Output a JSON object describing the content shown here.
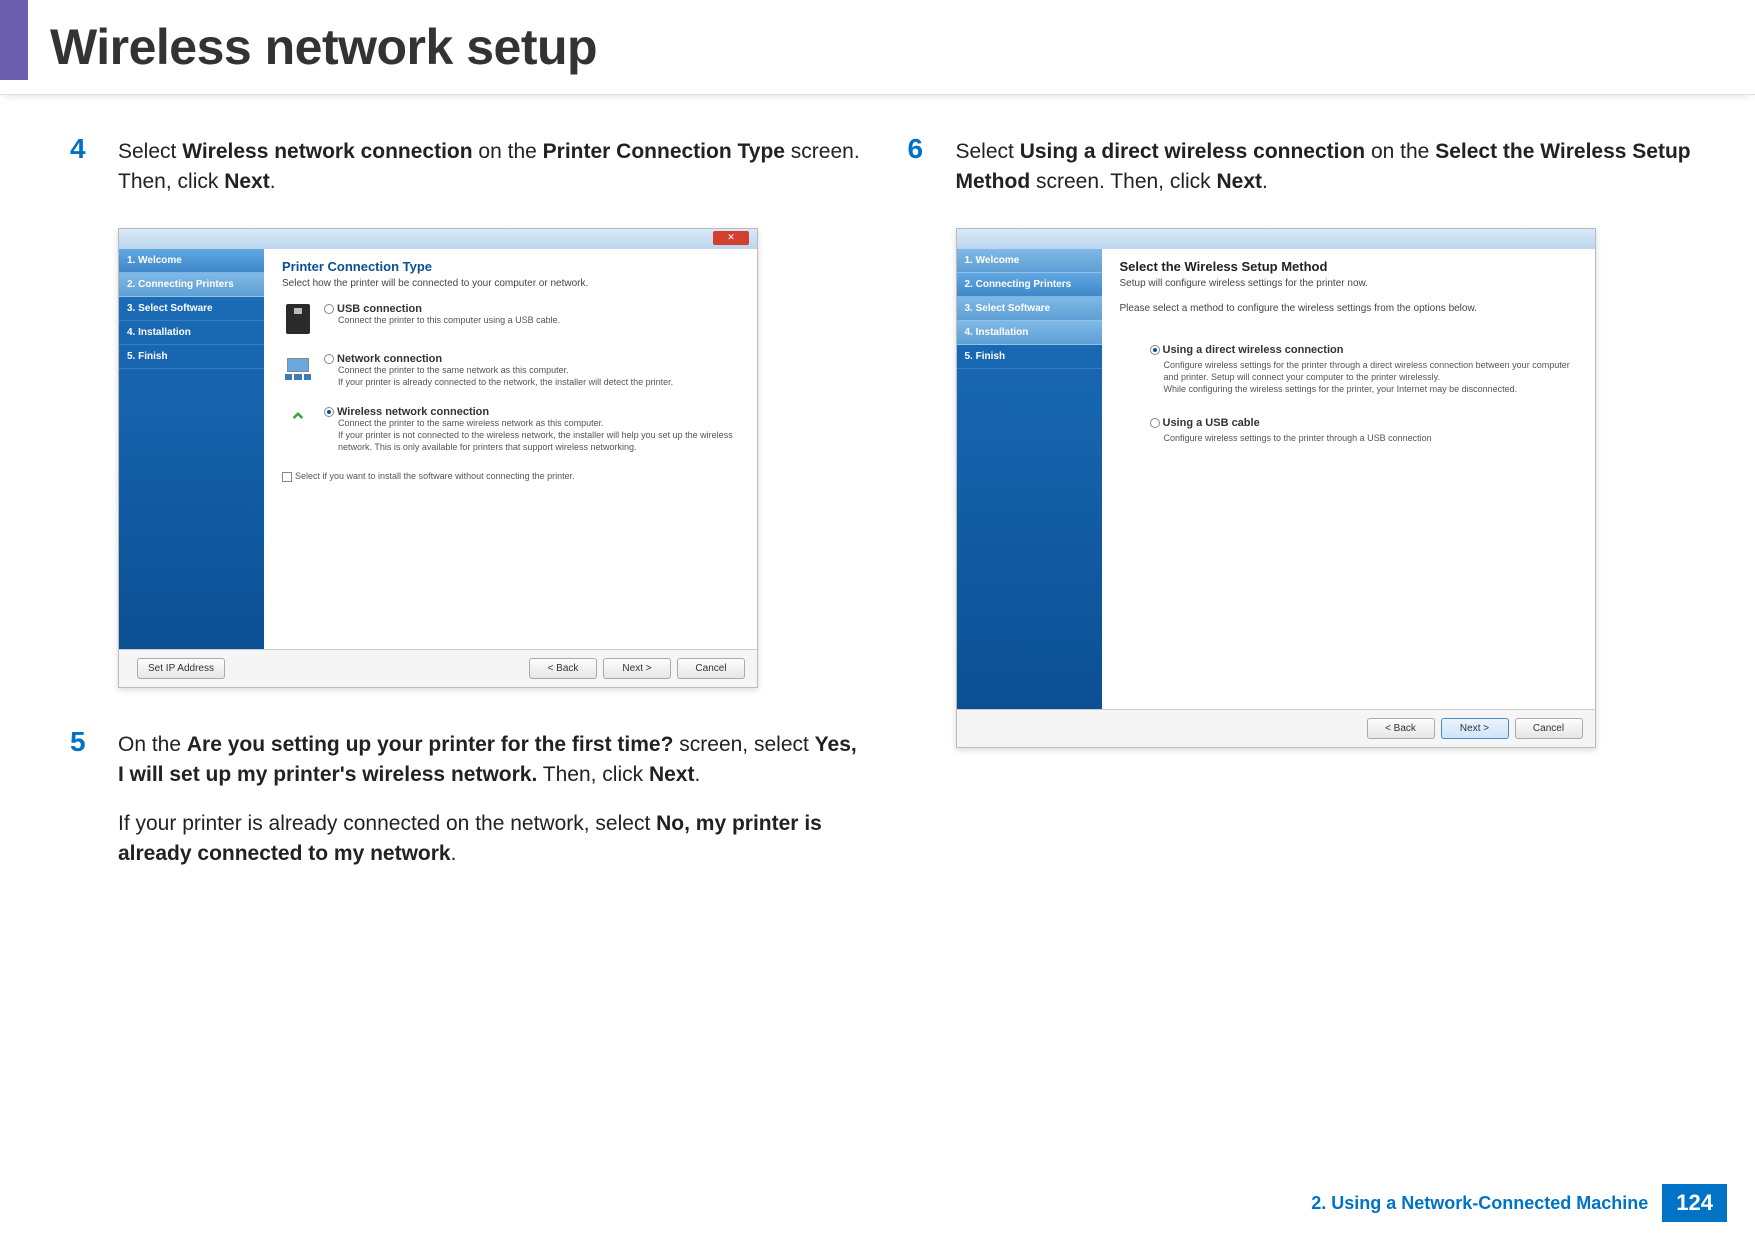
{
  "header": {
    "title": "Wireless network setup"
  },
  "footer": {
    "chapter": "2.  Using a Network-Connected Machine",
    "page": "124"
  },
  "steps": {
    "s4": {
      "num": "4",
      "t1": "Select ",
      "b1": "Wireless network connection",
      "t2": " on the ",
      "b2": "Printer Connection Type",
      "t3": " screen. Then, click ",
      "b3": "Next",
      "t4": "."
    },
    "s5": {
      "num": "5",
      "t1": "On the ",
      "b1": "Are you setting up your printer for the first time?",
      "t2": " screen, select ",
      "b2": "Yes, I will set up my printer's wireless network.",
      "t3": " Then, click ",
      "b3": "Next",
      "t4": ".",
      "p2_t1": "If your printer is already connected on the network, select ",
      "p2_b1": "No, my printer is already connected to my network",
      "p2_t2": "."
    },
    "s6": {
      "num": "6",
      "t1": "Select ",
      "b1": "Using a direct wireless connection",
      "t2": " on the ",
      "b2": "Select the Wireless Setup Method",
      "t3": " screen. Then, click ",
      "b3": "Next",
      "t4": "."
    }
  },
  "dialog1": {
    "side": [
      "1. Welcome",
      "2. Connecting Printers",
      "3. Select Software",
      "4. Installation",
      "5. Finish"
    ],
    "heading": "Printer Connection Type",
    "sub": "Select how the printer will be connected to your computer or network.",
    "opt_usb_title": "USB connection",
    "opt_usb_desc": "Connect the printer to this computer using a USB cable.",
    "opt_net_title": "Network connection",
    "opt_net_desc": "Connect the printer to the same network as this computer.\nIf your printer is already connected to the network, the installer will detect the printer.",
    "opt_wifi_title": "Wireless network connection",
    "opt_wifi_desc": "Connect the printer to the same wireless network as this computer.\nIf your printer is not connected to the wireless network, the installer will help you set up the wireless network. This is only available for printers that support wireless networking.",
    "extra": "Select if you want to install the software without connecting the printer.",
    "btn_left": "Set IP Address",
    "btn_back": "< Back",
    "btn_next": "Next >",
    "btn_cancel": "Cancel",
    "close": "✕"
  },
  "dialog2": {
    "side": [
      "1. Welcome",
      "2. Connecting Printers",
      "3. Select Software",
      "4. Installation",
      "5. Finish"
    ],
    "heading": "Select the Wireless Setup Method",
    "sub1": "Setup will configure wireless settings for the printer now.",
    "sub2": "Please select a method to configure the wireless settings from the options below.",
    "opt1_title": "Using a direct wireless connection",
    "opt1_desc": "Configure wireless settings for the printer through a direct wireless connection between your computer and printer. Setup will connect your computer to the printer wirelessly.\nWhile configuring the wireless settings for the printer, your Internet may be disconnected.",
    "opt2_title": "Using a USB cable",
    "opt2_desc": "Configure wireless settings to the printer through a USB connection",
    "btn_back": "< Back",
    "btn_next": "Next >",
    "btn_cancel": "Cancel"
  }
}
